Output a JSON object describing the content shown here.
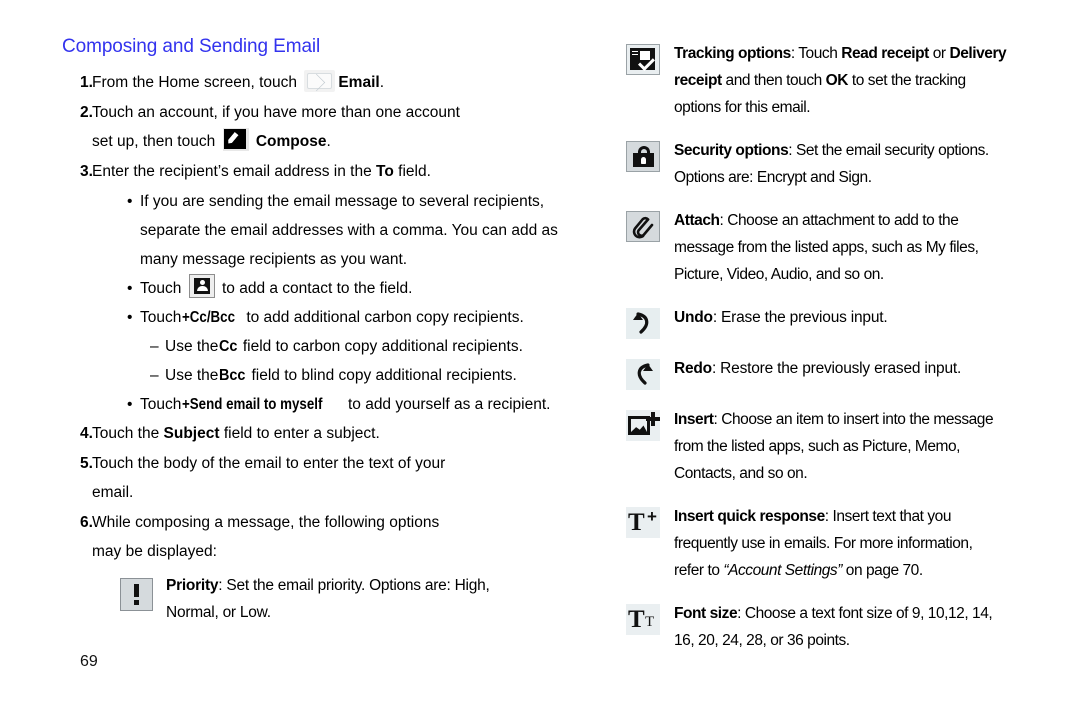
{
  "document": {
    "page_number": "69",
    "heading": "Composing and Sending Email",
    "heading_color": "#3333ee"
  },
  "left_column": {
    "steps": [
      {
        "number": "1.",
        "text_before_icon": "From the Home screen, touch ",
        "icon": "email-envelope-icon",
        "bold_label": "Email",
        "text_after": "."
      },
      {
        "number": "2.",
        "line1": "Touch an account, if you have more than one account",
        "line2_before_icon": "set up, then touch ",
        "icon": "compose-pencil-icon",
        "bold_label": "Compose",
        "text_after": "."
      },
      {
        "number": "3.",
        "text_a": "Enter the recipient’s email address in the ",
        "bold_b": "To",
        "text_c": " field."
      },
      {
        "number": "4.",
        "text_a": "Touch the ",
        "bold_b": "Subject",
        "text_c": " field to enter a subject."
      },
      {
        "number": "5.",
        "line1": "Touch the body of the email to enter the text of your",
        "line2": "email."
      },
      {
        "number": "6.",
        "line1": "While composing a message, the following options",
        "line2": "may be displayed:"
      }
    ],
    "bullets": [
      {
        "mark": "•",
        "line1": "If you are sending the email message to several recipients,",
        "line2": "separate the email addresses with a comma. You can add as",
        "line3": "many message recipients as you want."
      },
      {
        "mark": "•",
        "text_before_icon": "Touch ",
        "icon": "add-contact-icon",
        "text_after": " to add a contact to the field."
      },
      {
        "mark": "•",
        "text_a": "Touch ",
        "bold_b": "+Cc/Bcc",
        "text_c": " to add additional carbon copy recipients."
      },
      {
        "mark": "•",
        "text_a": "Touch ",
        "bold_b": "+Send email to myself",
        "text_c": " to add yourself as a recipient."
      }
    ],
    "sub_dashes": [
      {
        "mark": "–",
        "text_a": "Use the ",
        "bold_b": "Cc",
        "text_c": " field to carbon copy additional recipients."
      },
      {
        "mark": "–",
        "text_a": "Use the ",
        "bold_b": "Bcc",
        "text_c": " field to blind copy additional recipients."
      }
    ],
    "priority_option": {
      "icon": "priority-exclamation-icon",
      "bold_label": "Priority",
      "line1_rest": ": Set the email priority. Options are: High,",
      "line2": "Normal, or Low."
    }
  },
  "right_column": {
    "options": [
      {
        "icon": "tracking-options-icon",
        "bold_label": "Tracking options",
        "line1_a": ": Touch ",
        "line1_b": "Read receipt",
        "line1_c": " or ",
        "line1_d": "Delivery",
        "line2_a": "receipt",
        "line2_b": " and then touch ",
        "line2_c": "OK",
        "line2_d": " to set the tracking",
        "line3": "options for this email."
      },
      {
        "icon": "security-lock-icon",
        "bold_label": "Security options",
        "line1_rest": ": Set the email security options.",
        "line2": "Options are: Encrypt and Sign."
      },
      {
        "icon": "attach-paperclip-icon",
        "bold_label": "Attach",
        "line1_rest": ": Choose an attachment to add to the",
        "line2": "message from the listed apps, such as My files,",
        "line3": "Picture, Video, Audio, and so on."
      },
      {
        "icon": "undo-arrow-icon",
        "bold_label": "Undo",
        "line1_rest": ": Erase the previous input."
      },
      {
        "icon": "redo-arrow-icon",
        "bold_label": "Redo",
        "line1_rest": ": Restore the previously erased input."
      },
      {
        "icon": "insert-picture-plus-icon",
        "bold_label": "Insert",
        "line1_rest": ": Choose an item to insert into the message",
        "line2": "from the listed apps, such as Picture, Memo,",
        "line3": "Contacts, and so on."
      },
      {
        "icon": "insert-quick-response-icon",
        "bold_label": "Insert quick response",
        "line1_rest": ": Insert text that you",
        "line2": "frequently use in emails. For more information,",
        "line3_a": "refer to ",
        "line3_italic": "“Account Settings”",
        "line3_b": " on page 70."
      },
      {
        "icon": "font-size-icon",
        "bold_label": "Font size",
        "line1_rest": ": Choose a text font size of 9, 10,12, 14,",
        "line2": "16, 20, 24, 28, or 36 points."
      }
    ]
  }
}
